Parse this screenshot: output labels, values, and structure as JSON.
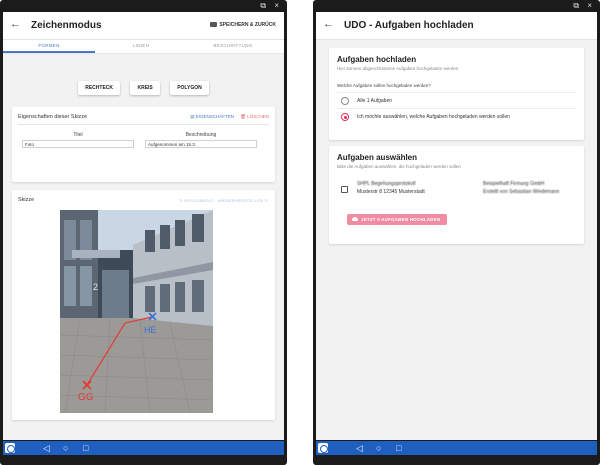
{
  "left_app": {
    "statusbar_icons": "⧉ ×",
    "title": "Zeichenmodus",
    "back_icon": "←",
    "save_label": "SPEICHERN & ZURÜCK",
    "tabs": [
      {
        "label": "FORMEN"
      },
      {
        "label": "LINIEN"
      },
      {
        "label": "BESCHRIFTUNG"
      }
    ],
    "shape_buttons": [
      {
        "label": "RECHTECK"
      },
      {
        "label": "KREIS"
      },
      {
        "label": "POLYGON"
      }
    ],
    "properties": {
      "title": "Eigenschaften dieser Skizze",
      "action_properties": "▤ EIGENSCHAFTEN",
      "action_delete": "🗑 LÖSCHEN",
      "col_title": "Titel",
      "col_description": "Beschreibung",
      "title_value": "Foto",
      "description_value": "Aufgenommen am 15.3."
    },
    "sketch": {
      "title": "Skizze",
      "actions": "↻ RÜCKGÄNGIG · WIEDERHERSTELLEN ↻",
      "label_he": "HE",
      "label_gg": "GG",
      "building_number": "2"
    }
  },
  "right_app": {
    "statusbar_icons": "⧉ ×",
    "title": "UDO - Aufgaben hochladen",
    "back_icon": "←",
    "upload_card": {
      "title": "Aufgaben hochladen",
      "subtitle": "Hier können abgeschlossene Aufgaben hochgeladen werden",
      "question": "Welche Aufgaben sollen hochgeladen werden?",
      "option_all": "Alle 1 Aufgaben",
      "option_select": "Ich möchte auswählen, welche Aufgaben hochgeladen werden sollen"
    },
    "select_card": {
      "title": "Aufgaben auswählen",
      "subtitle": "Bitte die Aufgaben auswählen, die hochgeladen werden sollen",
      "task": {
        "name": "SHPL Begehungsprotokoll",
        "address": "Musterstr 8 12345 Musterstadt",
        "company": "Beispielhaft Firmung GmbH",
        "creator": "Erstellt von Sebastian Wiedemann"
      },
      "upload_button": "JETZT 0 AUFGABEN HOCHLADEN"
    }
  },
  "navbar": {
    "back": "◁",
    "home": "○",
    "recent": "□"
  },
  "colors": {
    "primary": "#4a78c4",
    "navbar": "#1f5fbf",
    "accent": "#e0315a",
    "drawing": "#e53935",
    "he_marker": "#3a6fd8"
  }
}
